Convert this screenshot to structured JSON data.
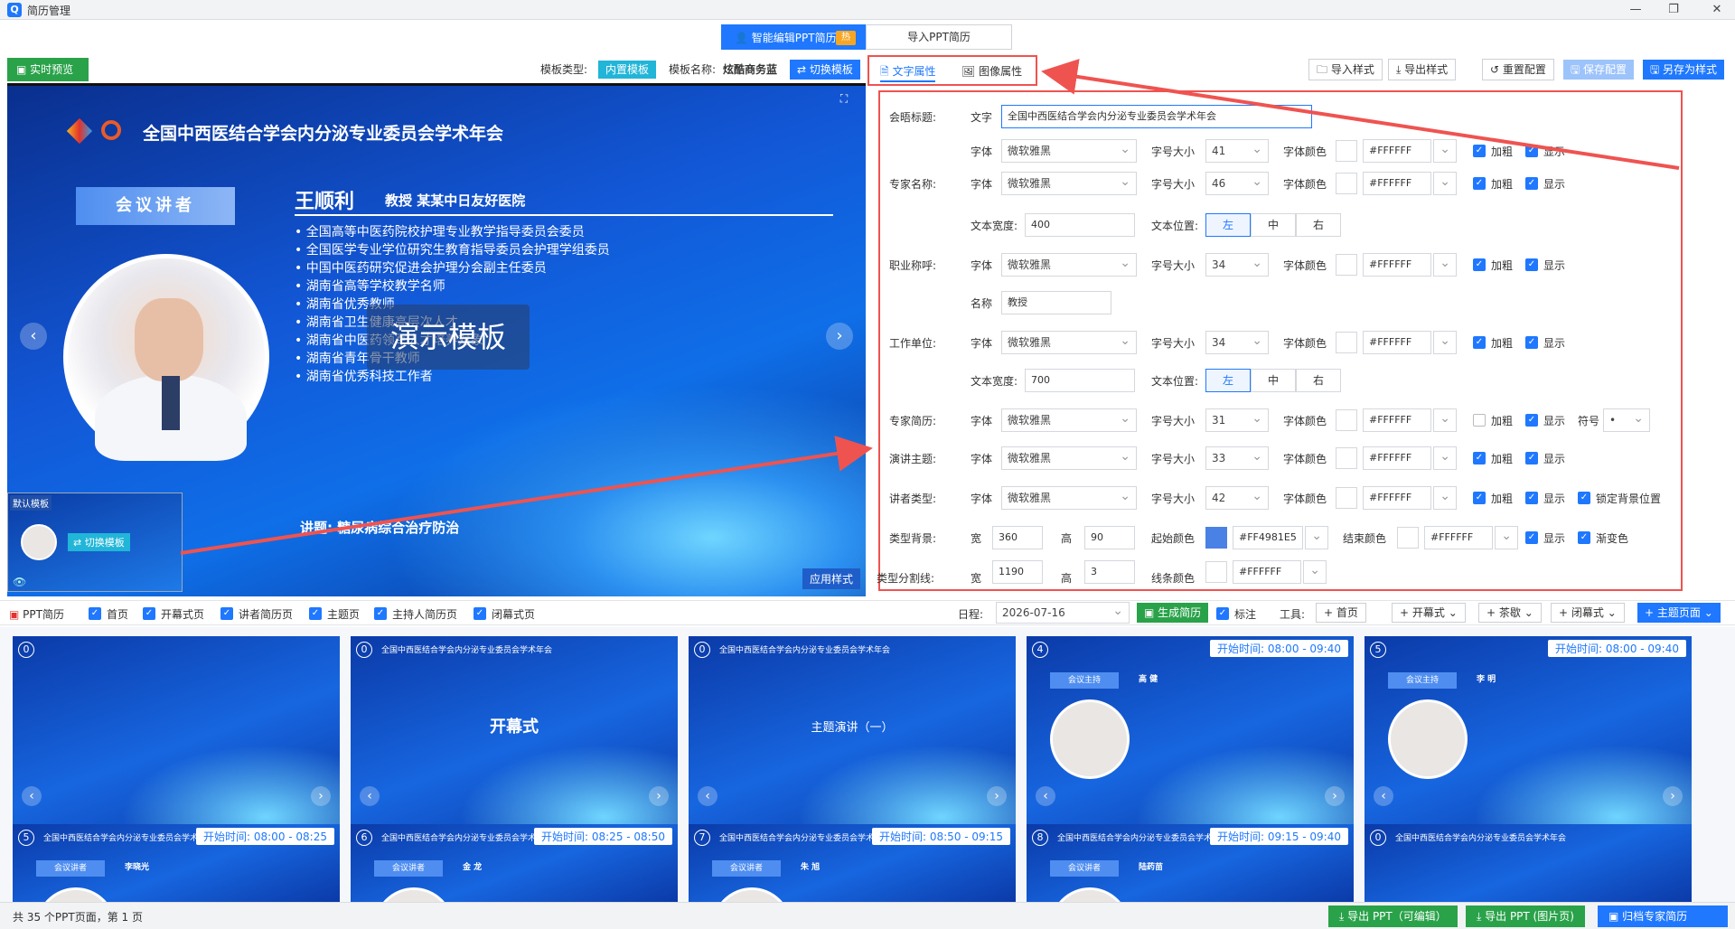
{
  "window": {
    "title": "简历管理",
    "icon": "Q",
    "min": "—",
    "max": "❐",
    "close": "✕"
  },
  "modes": {
    "edit_label": "智能编辑PPT简历",
    "hot_badge": "热",
    "import_label": "导入PPT简历"
  },
  "toolbar": {
    "live_preview": "实时预览",
    "template_type_label": "模板类型:",
    "template_type_value": "内置模板",
    "template_name_label": "模板名称:",
    "template_name_value": "炫酷商务蓝",
    "switch_template": "切换模板",
    "tab_text": "文字属性",
    "tab_image": "图像属性",
    "import_style": "导入样式",
    "export_style": "导出样式",
    "reset_config": "重置配置",
    "save_config": "保存配置",
    "save_as": "另存为样式"
  },
  "slide": {
    "title": "全国中西医结合学会内分泌专业委员会学术年会",
    "speaker_tag": "会议讲者",
    "name": "王顺利",
    "title_org": "教授  某某中日友好医院",
    "bio": [
      "全国高等中医药院校护理专业教学指导委员会委员",
      "全国医学专业学位研究生教育指导委员会护理学组委员",
      "中国中医药研究促进会护理分会副主任委员",
      "湖南省高等学校教学名师",
      "湖南省优秀教师",
      "湖南省卫生健康高层次人才",
      "湖南省中医药领军人才培养对象",
      "湖南省青年骨干教师",
      "湖南省优秀科技工作者"
    ],
    "watermark": "演示模板",
    "topic": "讲题: 糖尿病综合治疗防治",
    "thumb_label": "默认模板",
    "thumb_switch": "⇄ 切换模板",
    "apply_style": "应用样式"
  },
  "props": {
    "rows": [
      {
        "label": "会晤标题:",
        "text_label": "文字",
        "text_value": "全国中西医结合学会内分泌专业委员会学术年会"
      },
      {
        "font_label": "字体",
        "font": "微软雅黑",
        "size_label": "字号大小",
        "size": "41",
        "color_label": "字体颜色",
        "color": "#FFFFFF",
        "bold": "加粗",
        "show": "显示"
      },
      {
        "label": "专家名称:",
        "font": "微软雅黑",
        "size": "46",
        "color": "#FFFFFF"
      },
      {
        "width_label": "文本宽度:",
        "width": "400",
        "pos_label": "文本位置:",
        "left": "左",
        "center": "中",
        "right": "右"
      },
      {
        "label": "职业称呼:",
        "font": "微软雅黑",
        "size": "34",
        "color": "#FFFFFF"
      },
      {
        "name_label": "名称",
        "name_value": "教授"
      },
      {
        "label": "工作单位:",
        "font": "微软雅黑",
        "size": "34",
        "color": "#FFFFFF"
      },
      {
        "width": "700"
      },
      {
        "label": "专家简历:",
        "font": "微软雅黑",
        "size": "31",
        "color": "#FFFFFF",
        "symbol_label": "符号",
        "symbol": "•"
      },
      {
        "label": "演讲主题:",
        "font": "微软雅黑",
        "size": "33",
        "color": "#FFFFFF"
      },
      {
        "label": "讲者类型:",
        "font": "微软雅黑",
        "size": "42",
        "color": "#FFFFFF",
        "lock": "锁定背景位置"
      },
      {
        "label": "类型背景:",
        "w_label": "宽",
        "w": "360",
        "h_label": "高",
        "h": "90",
        "start_label": "起始颜色",
        "start": "#FF4981E5",
        "end_label": "结束颜色",
        "end": "#FFFFFF",
        "show": "显示",
        "gradient": "渐变色"
      },
      {
        "label": "类型分割线:",
        "w": "1190",
        "h": "3",
        "line_label": "线条颜色",
        "line": "#FFFFFF"
      }
    ]
  },
  "selection": {
    "ppt_label": "PPT简历",
    "items": [
      "首页",
      "开幕式页",
      "讲者简历页",
      "主题页",
      "主持人简历页",
      "闭幕式页"
    ],
    "date_label": "日程:",
    "date": "2026-07-16",
    "generate": "生成简历",
    "mark": "标注",
    "tools": "工具:",
    "add_home": "+ 首页",
    "add_open": "+ 开幕式",
    "add_tea": "+ 茶歇",
    "add_close": "+ 闭幕式",
    "add_theme": "+ 主题页面"
  },
  "cards": [
    {
      "num": "0",
      "title": "",
      "big": "",
      "mid": "",
      "time": ""
    },
    {
      "num": "0",
      "title": "全国中西医结合学会内分泌专业委员会学术年会",
      "big": "开幕式",
      "mid": "",
      "time": ""
    },
    {
      "num": "0",
      "title": "全国中西医结合学会内分泌专业委员会学术年会",
      "big": "",
      "mid": "主题演讲（一）",
      "time": ""
    },
    {
      "num": "4",
      "title": "全国中西医结合学会内分泌专业委员会学术年会",
      "tag": "会议主持",
      "name": "高 健",
      "time": "开始时间: 08:00 - 09:40"
    },
    {
      "num": "5",
      "title": "全国中西医结合学会内分泌专业委员会学术年会",
      "tag": "会议主持",
      "name": "李 明",
      "time": "开始时间: 08:00 - 09:40"
    },
    {
      "num": "5",
      "title": "全国中西医结合学会内分泌专业委员会学术年会",
      "tag": "会议讲者",
      "name": "李晓光",
      "time": "开始时间: 08:00 - 08:25"
    },
    {
      "num": "6",
      "title": "全国中西医结合学会内分泌专业委员会学术年会",
      "tag": "会议讲者",
      "name": "金 龙",
      "time": "开始时间: 08:25 - 08:50"
    },
    {
      "num": "7",
      "title": "全国中西医结合学会内分泌专业委员会学术年会",
      "tag": "会议讲者",
      "name": "朱 旭",
      "time": "开始时间: 08:50 - 09:15"
    },
    {
      "num": "8",
      "title": "全国中西医结合学会内分泌专业委员会学术年会",
      "tag": "会议讲者",
      "name": "陆药苗",
      "time": "开始时间: 09:15 - 09:40"
    },
    {
      "num": "0",
      "title": "全国中西医结合学会内分泌专业委员会学术年会",
      "big": "",
      "mid": "",
      "time": ""
    }
  ],
  "status": {
    "text": "共 35 个PPT页面，第 1 页",
    "export_edit": "导出 PPT（可编辑）",
    "export_image": "导出 PPT (图片页)",
    "archive": "归档专家简历"
  },
  "colors": {
    "accent": "#1f78ff",
    "green": "#2aa24a",
    "cyan": "#21b5d8",
    "annotation": "#ef5350"
  }
}
